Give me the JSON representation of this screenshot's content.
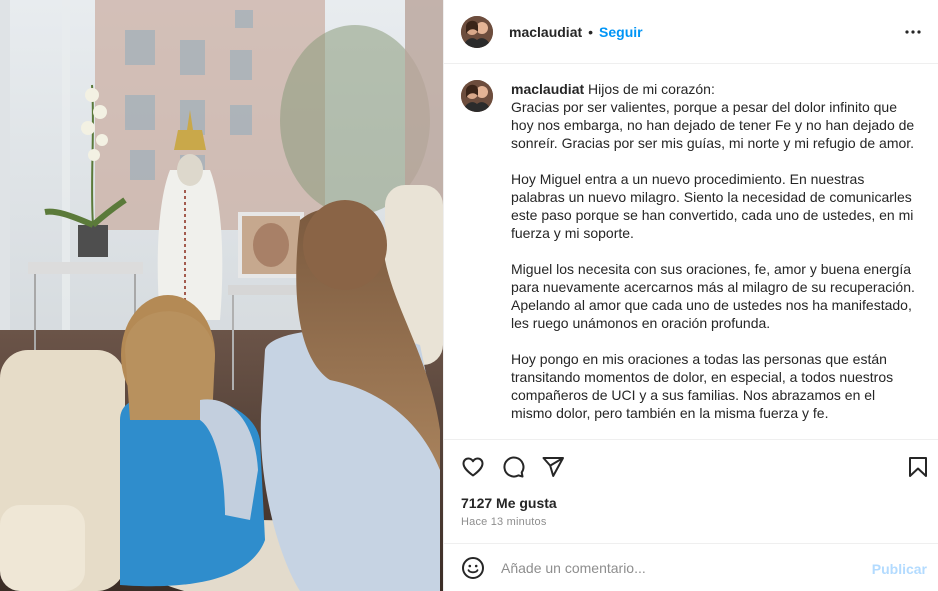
{
  "post": {
    "image_alt": "Photo of a child and a woman kneeling before a statue of the Virgin Mary near a window",
    "author": {
      "username": "maclaudiat",
      "follow_label": "Seguir",
      "separator": "•"
    },
    "caption": {
      "username": "maclaudiat",
      "paragraphs": [
        "Hijos de mi corazón:",
        "Gracias por ser valientes, porque a pesar del dolor infinito que hoy nos embarga, no han dejado de tener Fe y no han dejado de sonreír. Gracias por ser mis guías, mi norte y mi refugio de amor.",
        "Hoy Miguel entra a un nuevo procedimiento. En nuestras palabras un nuevo milagro. Siento la necesidad de comunicarles este paso porque se han convertido, cada uno de ustedes, en mi fuerza y mi soporte.",
        "Miguel los necesita con sus oraciones, fe, amor y buena energía para nuevamente acercarnos más al milagro de su recuperación. Apelando al amor que cada uno de ustedes nos ha manifestado, les ruego unámonos en oración profunda.",
        "Hoy pongo en mis oraciones a todas las personas que están transitando momentos de dolor, en especial, a todos nuestros compañeros de UCI y a sus familias. Nos abrazamos en el mismo dolor, pero también en la misma fuerza y fe."
      ]
    },
    "likes_text": "7127 Me gusta",
    "timestamp": "Hace 13 minutos",
    "icons": {
      "like": "heart-icon",
      "comment": "comment-bubble-icon",
      "share": "paper-plane-icon",
      "save": "bookmark-icon",
      "more": "more-dots-icon",
      "emoji": "smiley-icon"
    }
  },
  "comment_box": {
    "placeholder": "Añade un comentario...",
    "publish_label": "Publicar"
  },
  "colors": {
    "accent": "#0095f6",
    "publish_disabled": "#b3dbff",
    "secondary_text": "#8e8e8e",
    "divider": "#efefef"
  }
}
